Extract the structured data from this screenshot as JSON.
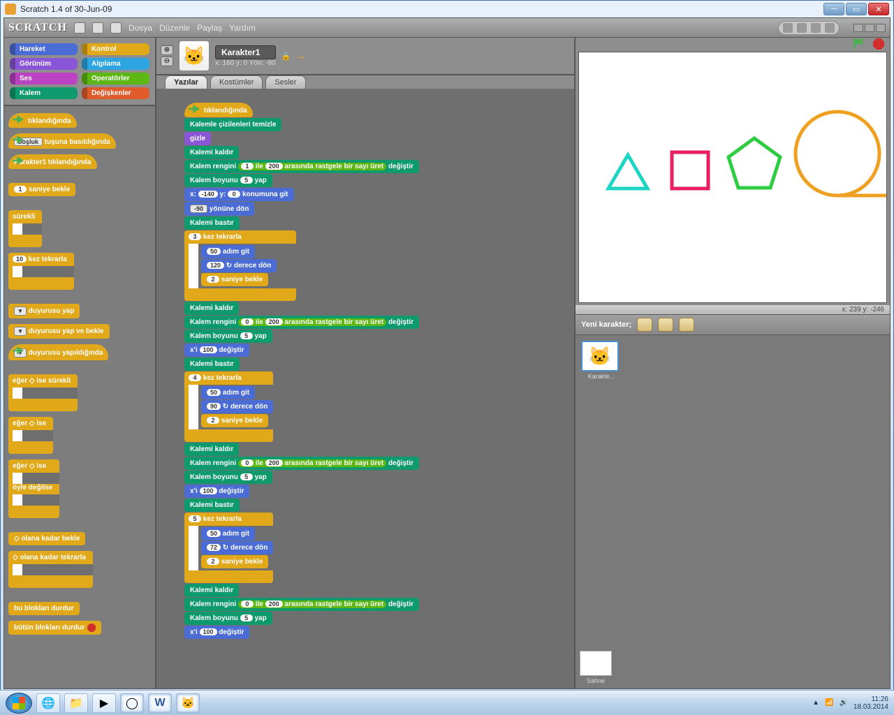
{
  "window": {
    "title": "Scratch 1.4 of 30-Jun-09"
  },
  "menu": {
    "file": "Dosya",
    "edit": "Düzenle",
    "share": "Paylaş",
    "help": "Yardım"
  },
  "categories": [
    {
      "label": "Hareket",
      "cls": "blue"
    },
    {
      "label": "Kontrol",
      "cls": "orange"
    },
    {
      "label": "Görünüm",
      "cls": "purple"
    },
    {
      "label": "Algılama",
      "cls": "lblue"
    },
    {
      "label": "Ses",
      "cls": "pink"
    },
    {
      "label": "Operatörler",
      "cls": "green"
    },
    {
      "label": "Kalem",
      "cls": "teal"
    },
    {
      "label": "Değişkenler",
      "cls": "red"
    }
  ],
  "palette": {
    "hat_click": "tıklandığında",
    "key_pressed_pre": "",
    "key_dd": "boşluk",
    "key_pressed_post": "tuşuna basıldığında",
    "sprite_clicked": "Karakter1 tıklandığında",
    "wait_num": "1",
    "wait_label": "saniye bekle",
    "forever": "sürekli",
    "repeat_num": "10",
    "repeat_label": "kez tekrarla",
    "broadcast": "duyurusu yap",
    "broadcast_wait": "duyurusu yap ve bekle",
    "when_receive": "duyurusu yapıldığında",
    "forever_if": "ise sürekli",
    "if": "ise",
    "if_else_if": "ise",
    "if_else_else": "öyle değilse",
    "wait_until": "olana kadar bekle",
    "repeat_until": "olana kadar tekrarla",
    "stop_script": "bu blokları durdur",
    "stop_all": "bütün blokları durdur",
    "eger": "eğer"
  },
  "sprite": {
    "name": "Karakter1",
    "info": "x: 160  y: 0     Yön: -90"
  },
  "tabs": {
    "scripts": "Yazılar",
    "costumes": "Kostümler",
    "sounds": "Sesler"
  },
  "stage_coords": "x: 239    y: -246",
  "new_sprite": "Yeni karakter;",
  "sprite_th": "Karakte...",
  "stage_label": "Sahne",
  "clock": {
    "time": "11:26",
    "date": "18.03.2014"
  },
  "script": {
    "hat": "tıklandığında",
    "clear": "Kalemle çizilenleri temizle",
    "hide": "gizle",
    "penup": "Kalemi kaldır",
    "pencolor_pre": "Kalem rengini",
    "pencolor_post": "değiştir",
    "rand_pre": "",
    "rand_mid": "ile",
    "rand_post": "arasında rastgele bir sayı üret",
    "pensize_pre": "Kalem boyunu",
    "pensize_val": "5",
    "pensize_post": "yap",
    "goto_pre": "x:",
    "goto_x": "-140",
    "goto_mid": "y:",
    "goto_y": "0",
    "goto_post": "konumuna git",
    "point_val": "-90",
    "point_post": "yönüne dön",
    "pendown": "Kalemi bastır",
    "repeat3": "3",
    "repeat4": "4",
    "repeat5": "5",
    "repeat_lbl": "kez tekrarla",
    "move_val": "50",
    "move_lbl": "adım git",
    "turn120": "120",
    "turn90": "90",
    "turn72": "72",
    "turn_lbl": "derece dön",
    "wait2": "2",
    "wait_lbl": "saniye bekle",
    "changex_pre": "x'i",
    "changex_val": "100",
    "changex_post": "değiştir",
    "rand_a": "0",
    "rand_a1": "1",
    "rand_b": "200"
  }
}
